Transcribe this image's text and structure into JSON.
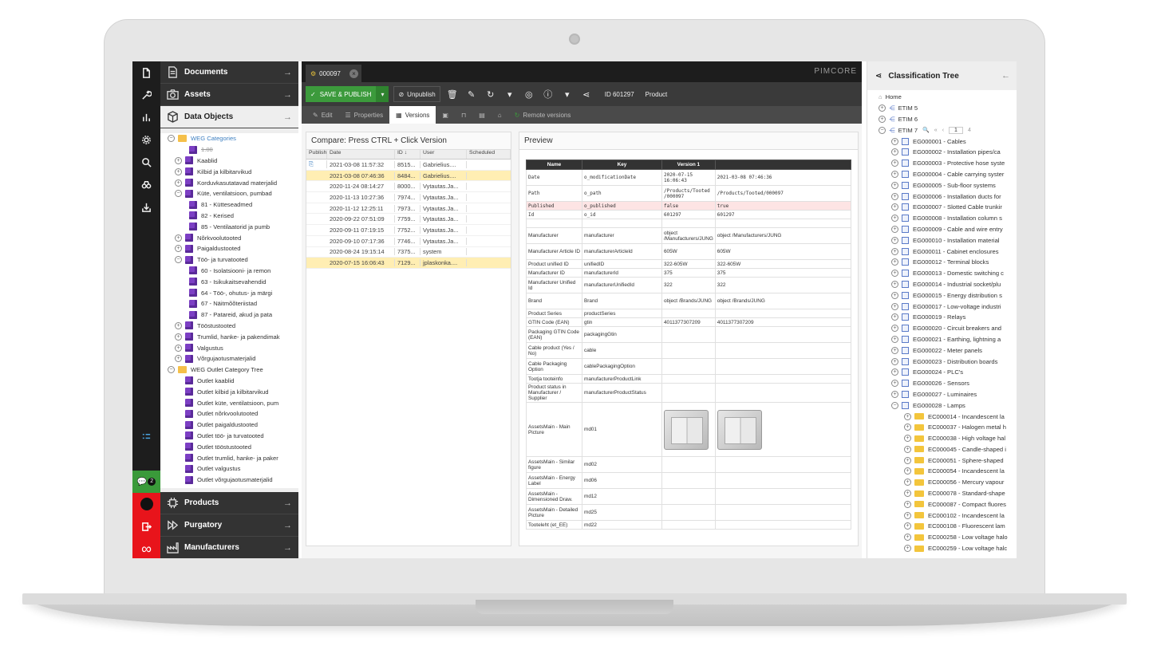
{
  "left_nav": {
    "main_sections": [
      {
        "label": "Documents",
        "icon": "document-icon"
      },
      {
        "label": "Assets",
        "icon": "camera-icon"
      },
      {
        "label": "Data Objects",
        "icon": "cube-icon"
      }
    ],
    "bottom_sections": [
      {
        "label": "Products",
        "icon": "chip-icon"
      },
      {
        "label": "Purgatory",
        "icon": "fast-forward-icon"
      },
      {
        "label": "Manufacturers",
        "icon": "factory-icon"
      }
    ],
    "chat_badge": "2"
  },
  "object_tree": {
    "root1": "WEG Categories",
    "items": [
      {
        "label": "1.00",
        "level": 2,
        "strike": true
      },
      {
        "label": "Kaablid",
        "level": 1
      },
      {
        "label": "Kilbid ja kilbitarvikud",
        "level": 1
      },
      {
        "label": "Korduvkasutatavad materjalid",
        "level": 1
      },
      {
        "label": "Küte, ventilatsioon, pumbad",
        "level": 1,
        "open": true
      },
      {
        "label": "81 - Kütteseadmed",
        "level": 2
      },
      {
        "label": "82 - Kerised",
        "level": 2
      },
      {
        "label": "85 - Ventilaatorid ja pumb",
        "level": 2
      },
      {
        "label": "Nõrkvoolutooted",
        "level": 1
      },
      {
        "label": "Paigaldustooted",
        "level": 1
      },
      {
        "label": "Töö- ja turvatooted",
        "level": 1,
        "open": true
      },
      {
        "label": "60 - Isolatsiooni- ja remon",
        "level": 2
      },
      {
        "label": "63 - Isikukaitsevahendid",
        "level": 2
      },
      {
        "label": "64 - Töö-, ohutus- ja märgi",
        "level": 2
      },
      {
        "label": "67 - Näitmõõteriistad",
        "level": 2
      },
      {
        "label": "87 - Patareid, akud ja pata",
        "level": 2
      },
      {
        "label": "Tööstustooted",
        "level": 1
      },
      {
        "label": "Trumlid, hanke- ja pakendimak",
        "level": 1
      },
      {
        "label": "Valgustus",
        "level": 1
      },
      {
        "label": "Võrgujaotusmaterjalid",
        "level": 1
      }
    ],
    "root2": "WEG Outlet Category Tree",
    "items2": [
      "Outlet kaablid",
      "Outlet kilbid ja kilbitarvikud",
      "Outlet küte, ventilatsioon, pum",
      "Outlet nõrkvoolutooted",
      "Outlet paigaldustooted",
      "Outlet töö- ja turvatooted",
      "Outlet tööstustooted",
      "Outlet trumlid, hanke- ja paker",
      "Outlet valgustus",
      "Outlet võrgujaotusmaterjalid"
    ]
  },
  "editor": {
    "tab_title": "000097",
    "brand": "PIMCORE",
    "save_label": "SAVE & PUBLISH",
    "unpublish_label": "Unpublish",
    "id_label": "ID 601297",
    "type_label": "Product",
    "subtabs": [
      "Edit",
      "Properties",
      "Versions",
      "Remote versions"
    ],
    "versions": {
      "caption": "Compare: Press CTRL + Click Version",
      "headers": [
        "Publish",
        "Date",
        "ID",
        "User",
        "Scheduled"
      ],
      "rows": [
        {
          "date": "2021-03-08 11:57:32",
          "id": "8515...",
          "user": "Gabrielius....",
          "hl": false
        },
        {
          "date": "2021-03-08 07:46:36",
          "id": "8484...",
          "user": "Gabrielius....",
          "hl": true
        },
        {
          "date": "2020-11-24 08:14:27",
          "id": "8000...",
          "user": "Vytautas.Ja...",
          "hl": false
        },
        {
          "date": "2020-11-13 10:27:36",
          "id": "7974...",
          "user": "Vytautas.Ja...",
          "hl": false
        },
        {
          "date": "2020-11-12 12:25:11",
          "id": "7973...",
          "user": "Vytautas.Ja...",
          "hl": false
        },
        {
          "date": "2020-09-22 07:51:09",
          "id": "7759...",
          "user": "Vytautas.Ja...",
          "hl": false
        },
        {
          "date": "2020-09-11 07:19:15",
          "id": "7752...",
          "user": "Vytautas.Ja...",
          "hl": false
        },
        {
          "date": "2020-09-10 07:17:36",
          "id": "7746...",
          "user": "Vytautas.Ja...",
          "hl": false
        },
        {
          "date": "2020-08-24 19:15:14",
          "id": "7375...",
          "user": "system",
          "hl": false
        },
        {
          "date": "2020-07-15 16:06:43",
          "id": "7129...",
          "user": "jplaskonka....",
          "hl": true
        }
      ]
    },
    "preview": {
      "caption": "Preview",
      "headers": [
        "Name",
        "Key",
        "Version 1",
        ""
      ],
      "rows": [
        {
          "name": "Date",
          "key": "o_modificationDate",
          "v1": "2020-07-15 16:06:43",
          "v2": "2021-03-08 07:46:36",
          "mono": true
        },
        {
          "name": "Path",
          "key": "o_path",
          "v1": "/Products/Tooted /000097",
          "v2": "/Products/Tooted/000097",
          "mono": true
        },
        {
          "name": "Published",
          "key": "o_published",
          "v1": "false",
          "v2": "true",
          "mono": true,
          "diff": true
        },
        {
          "name": "Id",
          "key": "o_id",
          "v1": "601297",
          "v2": "601297",
          "mono": true
        },
        {
          "name": "",
          "key": "",
          "v1": "",
          "v2": ""
        },
        {
          "name": "Manufacturer",
          "key": "manufacturer",
          "v1": "object /Manufacturers/JUNG",
          "v2": "object /Manufacturers/JUNG"
        },
        {
          "name": "Manufacturer Article ID",
          "key": "manufacturerArticleId",
          "v1": "605W",
          "v2": "605W"
        },
        {
          "name": "Product unified ID",
          "key": "unifiedID",
          "v1": "322-605W",
          "v2": "322-605W"
        },
        {
          "name": "Manufacturer ID",
          "key": "manufacturerId",
          "v1": "375",
          "v2": "375"
        },
        {
          "name": "Manufacturer Unified Id",
          "key": "manufacturerUnifiedId",
          "v1": "322",
          "v2": "322"
        },
        {
          "name": "Brand",
          "key": "Brand",
          "v1": "object /Brands/JUNG",
          "v2": "object /Brands/JUNG"
        },
        {
          "name": "Product Series",
          "key": "productSeries",
          "v1": "",
          "v2": ""
        },
        {
          "name": "GTIN Code (EAN)",
          "key": "gtin",
          "v1": "4011377307209",
          "v2": "4011377307209"
        },
        {
          "name": "Packaging GTIN Code (EAN)",
          "key": "packagingGtin",
          "v1": "",
          "v2": ""
        },
        {
          "name": "Cable product (Yes / No)",
          "key": "cable",
          "v1": "",
          "v2": ""
        },
        {
          "name": "Cable Packaging Option",
          "key": "cablePackagingOption",
          "v1": "",
          "v2": ""
        },
        {
          "name": "Tootja tooteinfo",
          "key": "manufacturerProductLink",
          "v1": "",
          "v2": ""
        },
        {
          "name": "Product status in Manufacturer / Supplier",
          "key": "manufacturerProductStatus",
          "v1": "",
          "v2": ""
        },
        {
          "name": "AssetsMain - Main Picture",
          "key": "md01",
          "v1": "",
          "v2": "",
          "image": true
        },
        {
          "name": "AssetsMain - Similar figure",
          "key": "md02",
          "v1": "",
          "v2": ""
        },
        {
          "name": "AssetsMain - Energy Label",
          "key": "md06",
          "v1": "",
          "v2": ""
        },
        {
          "name": "AssetsMain - Dimensioned Draw.",
          "key": "md12",
          "v1": "",
          "v2": ""
        },
        {
          "name": "AssetsMain - Detailed Picture",
          "key": "md25",
          "v1": "",
          "v2": ""
        },
        {
          "name": "Tooteleht (et_EE)",
          "key": "md22",
          "v1": "",
          "v2": ""
        }
      ]
    }
  },
  "classification": {
    "title": "Classification Tree",
    "home": "Home",
    "etims": [
      "ETIM 5",
      "ETIM 6",
      "ETIM 7"
    ],
    "pager_page": "1",
    "pager_total": "4",
    "groups": [
      "EG000001 - Cables",
      "EG000002 - Installation pipes/ca",
      "EG000003 - Protective hose syste",
      "EG000004 - Cable carrying syster",
      "EG000005 - Sub-floor systems",
      "EG000006 - Installation ducts for",
      "EG000007 - Slotted Cable trunkir",
      "EG000008 - Installation column s",
      "EG000009 - Cable and wire entry",
      "EG000010 - Installation material",
      "EG000011 - Cabinet enclosures",
      "EG000012 - Terminal blocks",
      "EG000013 - Domestic switching c",
      "EG000014 - Industrial socket/plu",
      "EG000015 - Energy distribution s",
      "EG000017 - Low-voltage industri",
      "EG000019 - Relays",
      "EG000020 - Circuit breakers and",
      "EG000021 - Earthing, lightning a",
      "EG000022 - Meter panels",
      "EG000023 - Distribution boards",
      "EG000024 - PLC's",
      "EG000026 - Sensors",
      "EG000027 - Luminaires",
      "EG000028 - Lamps"
    ],
    "classes": [
      "EC000014 - Incandescent la",
      "EC000037 - Halogen metal h",
      "EC000038 - High voltage hal",
      "EC000045 - Candle-shaped i",
      "EC000051 - Sphere-shaped",
      "EC000054 - Incandescent la",
      "EC000056 - Mercury vapour",
      "EC000078 - Standard-shape",
      "EC000087 - Compact fluores",
      "EC000102 - Incandescent la",
      "EC000108 - Fluorescent lam",
      "EC000258 - Low voltage halo",
      "EC000259 - Low voltage halc"
    ]
  }
}
